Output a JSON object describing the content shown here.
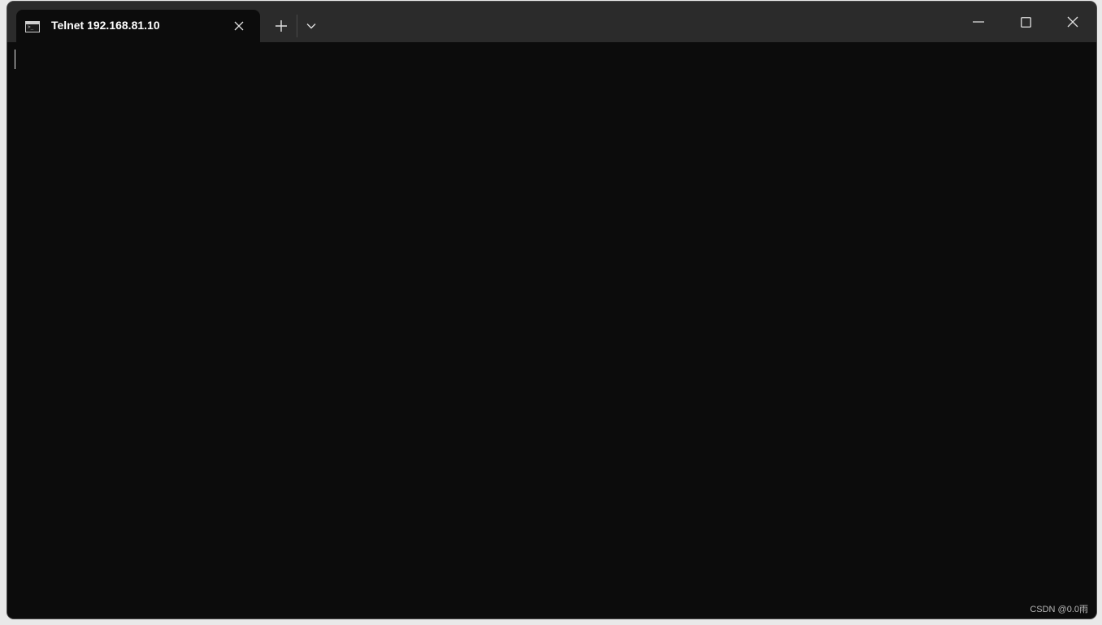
{
  "tab": {
    "title": "Telnet 192.168.81.10",
    "icon": "terminal-icon",
    "icon_prompt": ">_"
  },
  "titlebar": {
    "close_tab_icon": "close-icon",
    "new_tab_icon": "plus-icon",
    "dropdown_icon": "chevron-down-icon"
  },
  "window_controls": {
    "minimize_icon": "minimize-icon",
    "maximize_icon": "maximize-icon",
    "close_icon": "close-icon"
  },
  "terminal": {
    "content": ""
  },
  "watermark": {
    "text": "CSDN @0.0雨"
  },
  "colors": {
    "terminal_bg": "#0c0c0c",
    "titlebar_bg": "#2b2b2b",
    "text": "#ffffff"
  }
}
